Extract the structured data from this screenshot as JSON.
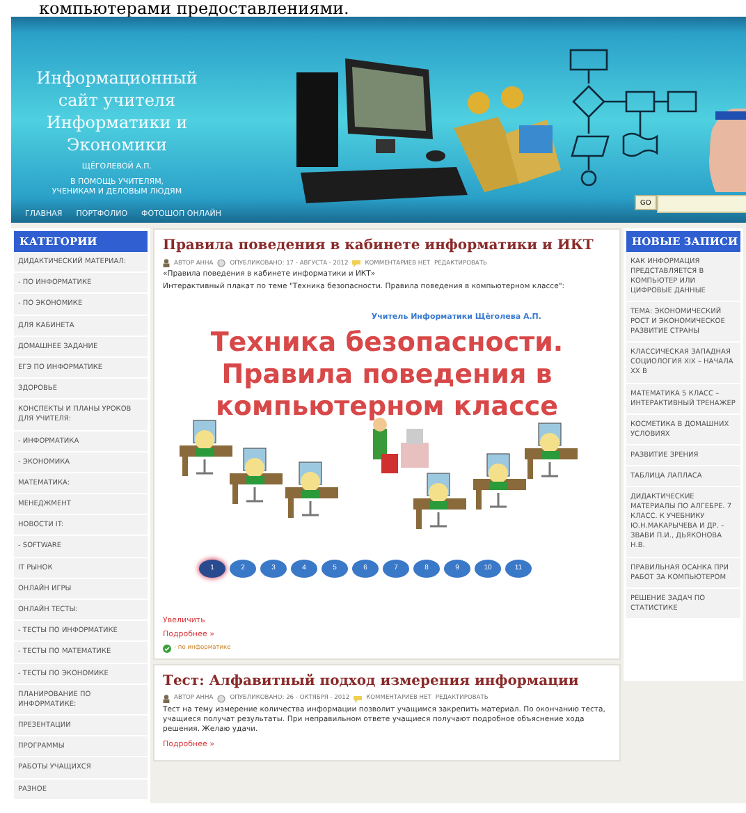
{
  "top_caption": "компьютерами предоставлениями.",
  "header": {
    "title_lines": [
      "Информационный",
      "сайт учителя",
      "Информатики и",
      "Экономики"
    ],
    "author": "ЩЁГОЛЕВОЙ А.П.",
    "tagline_lines": [
      "В ПОМОЩЬ УЧИТЕЛЯМ,",
      "УЧЕНИКАМ И ДЕЛОВЫМ ЛЮДЯМ"
    ],
    "search_button": "GO",
    "nav": [
      "ГЛАВНАЯ",
      "ПОРТФОЛИО",
      "ФОТОШОП ОНЛАЙН"
    ]
  },
  "categories": {
    "title": "КАТЕГОРИИ",
    "items": [
      "ДИДАКТИЧЕСКИЙ МАТЕРИАЛ:",
      "- ПО ИНФОРМАТИКЕ",
      "- ПО ЭКОНОМИКЕ",
      "ДЛЯ КАБИНЕТА",
      "ДОМАШНЕЕ ЗАДАНИЕ",
      "ЕГЭ ПО ИНФОРМАТИКЕ",
      "ЗДОРОВЬЕ",
      "КОНСПЕКТЫ И ПЛАНЫ УРОКОВ ДЛЯ УЧИТЕЛЯ:",
      "- ИНФОРМАТИКА",
      "- ЭКОНОМИКА",
      "МАТЕМАТИКА:",
      "МЕНЕДЖМЕНТ",
      "НОВОСТИ IT:",
      "- SOFTWARE",
      "IT РЫНОК",
      "ОНЛАЙН ИГРЫ",
      "ОНЛАЙН ТЕСТЫ:",
      "- ТЕСТЫ ПО ИНФОРМАТИКЕ",
      "- ТЕСТЫ ПО МАТЕМАТИКЕ",
      "- ТЕСТЫ ПО ЭКОНОМИКЕ",
      "ПЛАНИРОВАНИЕ ПО ИНФОРМАТИКЕ:",
      "ПРЕЗЕНТАЦИИ",
      "ПРОГРАММЫ",
      "РАБОТЫ УЧАЩИХСЯ",
      "РАЗНОЕ"
    ]
  },
  "posts": [
    {
      "title": "Правила поведения в кабинете информатики и ИКТ",
      "author": "АВТОР АННА",
      "published": "ОПУБЛИКОВАНО: 17 - АВГУСТА - 2012",
      "comments": "КОММЕНТАРИЕВ НЕТ",
      "edit": "РЕДАКТИРОВАТЬ",
      "paragraphs": [
        "«Правила поведения в кабинете информатики и ИКТ»",
        "Интерактивный плакат по теме \"Техника безопасности. Правила поведения в компьютерном классе\":"
      ],
      "poster": {
        "caption": "Учитель Информатики Щёголева А.П.",
        "heading_lines": [
          "Техника безопасности.",
          "Правила поведения в",
          "компьютерном классе"
        ],
        "pager": [
          {
            "label": "1",
            "selected": true
          },
          {
            "label": "2",
            "selected": false
          },
          {
            "label": "3",
            "selected": false
          },
          {
            "label": "4",
            "selected": false
          },
          {
            "label": "5",
            "selected": false
          },
          {
            "label": "6",
            "selected": false
          },
          {
            "label": "7",
            "selected": false
          },
          {
            "label": "8",
            "selected": false
          },
          {
            "label": "9",
            "selected": false
          },
          {
            "label": "10",
            "selected": false
          },
          {
            "label": "11",
            "selected": false
          }
        ]
      },
      "zoom_link": "Увеличить",
      "more_link": "Подробнее »",
      "category": "- по информатике"
    },
    {
      "title": "Тест: Алфавитный подход измерения информации",
      "author": "АВТОР АННА",
      "published": "ОПУБЛИКОВАНО: 26 - ОКТЯБРЯ - 2012",
      "comments": "КОММЕНТАРИЕВ НЕТ",
      "edit": "РЕДАКТИРОВАТЬ",
      "paragraphs": [
        "Тест на тему измерение количества информации позволит учащимся закрепить материал. По окончанию теста, учащиеся получат результаты. При неправильном ответе учащиеся получают подробное объяснение хода решения. Желаю удачи."
      ],
      "more_link": "Подробнее »"
    }
  ],
  "recent": {
    "title": "НОВЫЕ ЗАПИСИ",
    "items": [
      "КАК ИНФОРМАЦИЯ ПРЕДСТАВЛЯЕТСЯ В КОМПЬЮТЕР ИЛИ ЦИФРОВЫЕ ДАННЫЕ",
      "ТЕМА: ЭКОНОМИЧЕСКИЙ РОСТ И ЭКОНОМИЧЕСКОЕ РАЗВИТИЕ СТРАНЫ",
      "КЛАССИЧЕСКАЯ ЗАПАДНАЯ СОЦИОЛОГИЯ XIX – НАЧАЛА XX В",
      "МАТЕМАТИКА 5 КЛАСС – ИНТЕРАКТИВНЫЙ ТРЕНАЖЕР",
      "КОСМЕТИКА В ДОМАШНИХ УСЛОВИЯХ",
      "РАЗВИТИЕ ЗРЕНИЯ",
      "ТАБЛИЦА ЛАПЛАСА",
      "ДИДАКТИЧЕСКИЕ МАТЕРИАЛЫ ПО АЛГЕБРЕ. 7 КЛАСС. К УЧЕБНИКУ Ю.Н.МАКАРЫЧЕВА И ДР. – ЗВАВИ П.И., ДЬЯКОНОВА Н.В.",
      "ПРАВИЛЬНАЯ ОСАНКА ПРИ РАБОТ ЗА КОМПЬЮТЕРОМ",
      "РЕШЕНИЕ ЗАДАЧ ПО СТАТИСТИКЕ"
    ]
  }
}
